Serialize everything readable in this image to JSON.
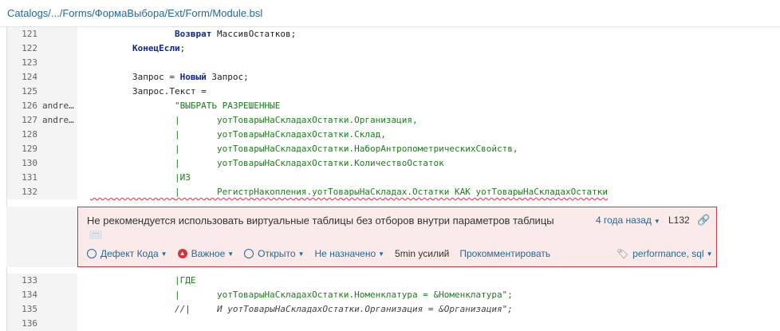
{
  "file_path": "Catalogs/.../Forms/ФормаВыбора/Ext/Form/Module.bsl",
  "lines_top": [
    {
      "num": "121",
      "author": "",
      "parts": [
        {
          "t": "                Возврат ",
          "c": "kw"
        },
        {
          "t": "МассивОстатков;",
          "c": ""
        }
      ]
    },
    {
      "num": "122",
      "author": "",
      "parts": [
        {
          "t": "        ",
          "c": ""
        },
        {
          "t": "КонецЕсли",
          "c": "kw"
        },
        {
          "t": ";",
          "c": ""
        }
      ]
    },
    {
      "num": "123",
      "author": "",
      "parts": []
    },
    {
      "num": "124",
      "author": "",
      "parts": [
        {
          "t": "        Запрос = ",
          "c": ""
        },
        {
          "t": "Новый",
          "c": "kw"
        },
        {
          "t": " Запрос;",
          "c": ""
        }
      ]
    },
    {
      "num": "125",
      "author": "",
      "parts": [
        {
          "t": "        Запрос.Текст =",
          "c": ""
        }
      ]
    },
    {
      "num": "126",
      "author": "andre…",
      "parts": [
        {
          "t": "                ",
          "c": ""
        },
        {
          "t": "\"ВЫБРАТЬ РАЗРЕШЕННЫЕ",
          "c": "str"
        }
      ]
    },
    {
      "num": "127",
      "author": "andre…",
      "parts": [
        {
          "t": "                ",
          "c": ""
        },
        {
          "t": "|       уотТоварыНаСкладахОстатки.Организация,",
          "c": "str"
        }
      ]
    },
    {
      "num": "128",
      "author": "",
      "parts": [
        {
          "t": "                ",
          "c": ""
        },
        {
          "t": "|       уотТоварыНаСкладахОстатки.Склад,",
          "c": "str"
        }
      ]
    },
    {
      "num": "129",
      "author": "",
      "parts": [
        {
          "t": "                ",
          "c": ""
        },
        {
          "t": "|       уотТоварыНаСкладахОстатки.НаборАнтропометрическихСвойств,",
          "c": "str"
        }
      ]
    },
    {
      "num": "130",
      "author": "",
      "parts": [
        {
          "t": "                ",
          "c": ""
        },
        {
          "t": "|       уотТоварыНаСкладахОстатки.КоличествоОстаток",
          "c": "str"
        }
      ]
    },
    {
      "num": "131",
      "author": "",
      "parts": [
        {
          "t": "                ",
          "c": ""
        },
        {
          "t": "|ИЗ",
          "c": "str"
        }
      ]
    },
    {
      "num": "132",
      "author": "",
      "parts": [
        {
          "t": "                ",
          "c": "squiggle"
        },
        {
          "t": "|       РегистрНакопления.уотТоварыНаСкладах.Остатки КАК уотТоварыНаСкладахОстатки",
          "c": "str squiggle"
        }
      ]
    }
  ],
  "issue": {
    "message": "Не рекомендуется использовать виртуальные таблицы без отборов внутри параметров таблицы",
    "more": "···",
    "age": "4 года назад",
    "line_ref": "L132",
    "type": "Дефект Кода",
    "severity": "Важное",
    "status": "Открыто",
    "assignee": "Не назначено",
    "effort": "5min усилий",
    "comment": "Прокомментировать",
    "tags": "performance, sql",
    "icons": {
      "type": "bug-icon",
      "severity": "major-severity-icon",
      "status": "open-status-icon",
      "link": "link-icon",
      "tags": "tag-icon"
    }
  },
  "lines_bottom": [
    {
      "num": "133",
      "author": "",
      "parts": [
        {
          "t": "                ",
          "c": ""
        },
        {
          "t": "|ГДЕ",
          "c": "str"
        }
      ]
    },
    {
      "num": "134",
      "author": "",
      "parts": [
        {
          "t": "                ",
          "c": ""
        },
        {
          "t": "|       уотТоварыНаСкладахОстатки.Номенклатура = &Номенклатура\";",
          "c": "str"
        }
      ]
    },
    {
      "num": "135",
      "author": "",
      "parts": [
        {
          "t": "                ",
          "c": ""
        },
        {
          "t": "//|     И уотТоварыНаСкладахОстатки.Организация = &Организация\";",
          "c": "cmt"
        }
      ]
    },
    {
      "num": "136",
      "author": "",
      "parts": []
    }
  ]
}
